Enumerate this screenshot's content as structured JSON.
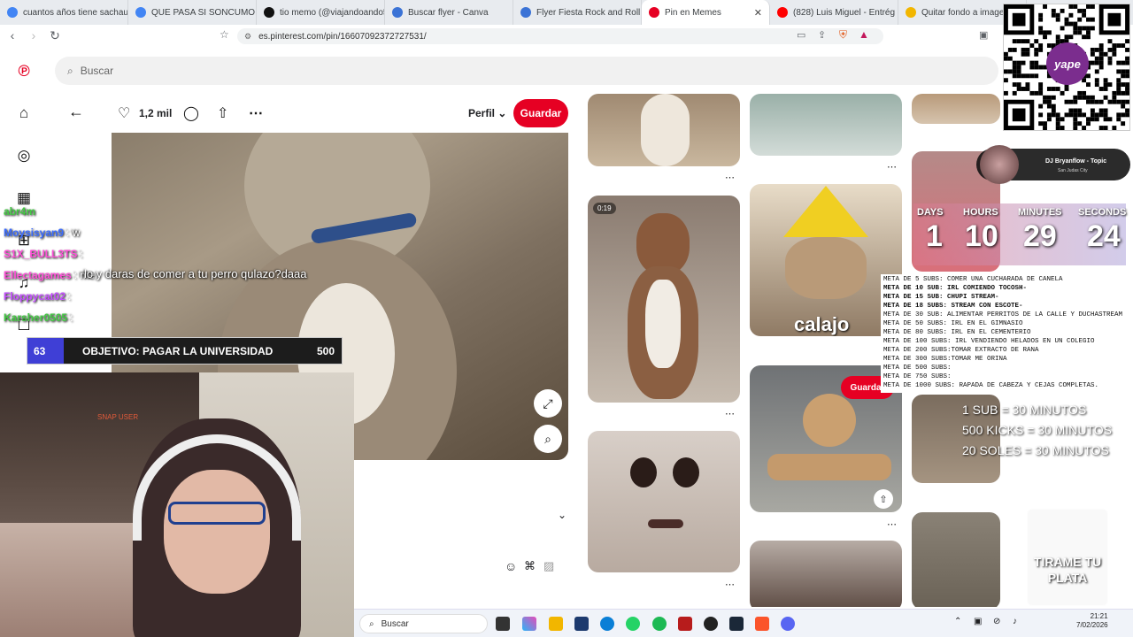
{
  "browser": {
    "tabs": [
      {
        "title": "cuantos años tiene sachauzun",
        "favicon_color": "#4285f4",
        "active": false
      },
      {
        "title": "QUE PASA SI SONCUMO MUC",
        "favicon_color": "#4285f4",
        "active": false
      },
      {
        "title": "tio memo (@viajandoando590",
        "favicon_color": "#111111",
        "active": false
      },
      {
        "title": "Buscar flyer - Canva",
        "favicon_color": "#3b73d6",
        "active": false
      },
      {
        "title": "Flyer Fiesta Rock and Roll Hea",
        "favicon_color": "#3b73d6",
        "active": false
      },
      {
        "title": "Pin en Memes",
        "favicon_color": "#e60023",
        "active": true
      },
      {
        "title": "(828) Luis Miguel - Entrég",
        "favicon_color": "#ff0000",
        "active": false
      },
      {
        "title": "Quitar fondo a imagenes onl",
        "favicon_color": "#f2b600",
        "active": false
      }
    ],
    "close_glyph": "✕",
    "url": "es.pinterest.com/pin/16607092372727531/"
  },
  "pinterest": {
    "search_placeholder": "Buscar",
    "like_count": "1,2 mil",
    "profile_label": "Perfil",
    "save_label": "Guardar",
    "hover_save_label": "Guardar",
    "video_time": "0:19",
    "meme_caption": "calajo"
  },
  "stream": {
    "chat": [
      {
        "user": "abr4m",
        "color": "#43c943",
        "msg": ""
      },
      {
        "user": "Moysisyan9",
        "color": "#3a6bff",
        "msg": ": w"
      },
      {
        "user": "S1X_BULL3TS",
        "color": "#ff4fd8",
        "msg": ":"
      },
      {
        "user": "Ellectagames",
        "color": "#ff4fd8",
        "msg": ": me"
      },
      {
        "user": "Floppycat02",
        "color": "#c44dff",
        "msg": ":"
      },
      {
        "user": "Karsher0505",
        "color": "#43c943",
        "msg": ":"
      }
    ],
    "overlay_message": "lo y daras de comer a tu perro qulazo?daaa",
    "goal": {
      "current": "63",
      "label": "OBJETIVO: PAGAR LA UNIVERSIDAD",
      "target": "500"
    },
    "webcam_label": "SNAP USER",
    "timer": {
      "labels": [
        "DAYS",
        "HOURS",
        "MINUTES",
        "SECONDS"
      ],
      "values": [
        "1",
        "10",
        "29",
        "24"
      ]
    },
    "dj": {
      "title": "DJ Bryanflow - Topic",
      "subtitle": "San Judas City"
    },
    "metas": [
      "META DE 5 SUBS: COMER UNA CUCHARADA DE CANELA",
      "META DE 10 SUB: IRL COMIENDO TOCOSH-",
      "META DE 15 SUB: CHUPI STREAM-",
      "META DE 18 SUBS: STREAM CON ESCOTE-",
      "META DE 30 SUB:  ALIMENTAR PERRITOS DE LA CALLE Y DUCHASTREAM",
      "META DE 50 SUBS: IRL EN EL GIMNASIO",
      "META DE 80 SUBS: IRL EN EL CEMENTERIO",
      "META DE 100 SUBS: IRL VENDIENDO HELADOS EN UN COLEGIO",
      "META DE 200 SUBS:TOMAR EXTRACTO DE RANA",
      "META DE 300 SUBS:TOMAR ME ORINA",
      "META DE 500 SUBS:",
      "META DE 750 SUBS:",
      "META DE 1000 SUBS: RAPADA DE CABEZA Y CEJAS COMPLETAS."
    ],
    "rates": [
      "1 SUB = 30 MINUTOS",
      "500 KICKS = 30 MINUTOS",
      "20 SOLES = 30 MINUTOS"
    ],
    "tip_jar": "TIRAME TU PLATA",
    "yape_label": "yape"
  },
  "taskbar": {
    "search_placeholder": "Buscar",
    "time": "21:21",
    "date": "7/02/2026"
  }
}
